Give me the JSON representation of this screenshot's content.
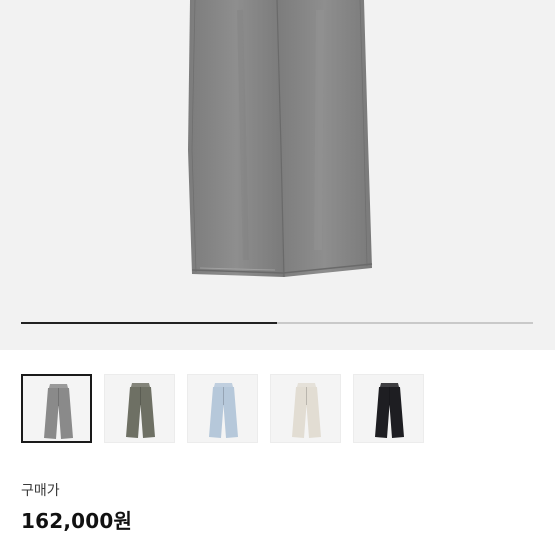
{
  "product": {
    "image_icon": "pants-icon",
    "gallery_progress": 0.5,
    "thumbnails": [
      {
        "name": "thumbnail-gray",
        "color": "#8a8a8a",
        "selected": true
      },
      {
        "name": "thumbnail-khaki",
        "color": "#6e7064",
        "selected": false
      },
      {
        "name": "thumbnail-light-blue",
        "color": "#b6c8da",
        "selected": false
      },
      {
        "name": "thumbnail-ivory",
        "color": "#e2ddd3",
        "selected": false
      },
      {
        "name": "thumbnail-black",
        "color": "#1e1e22",
        "selected": false
      }
    ]
  },
  "price_label": "구매가",
  "price": "162,000원"
}
